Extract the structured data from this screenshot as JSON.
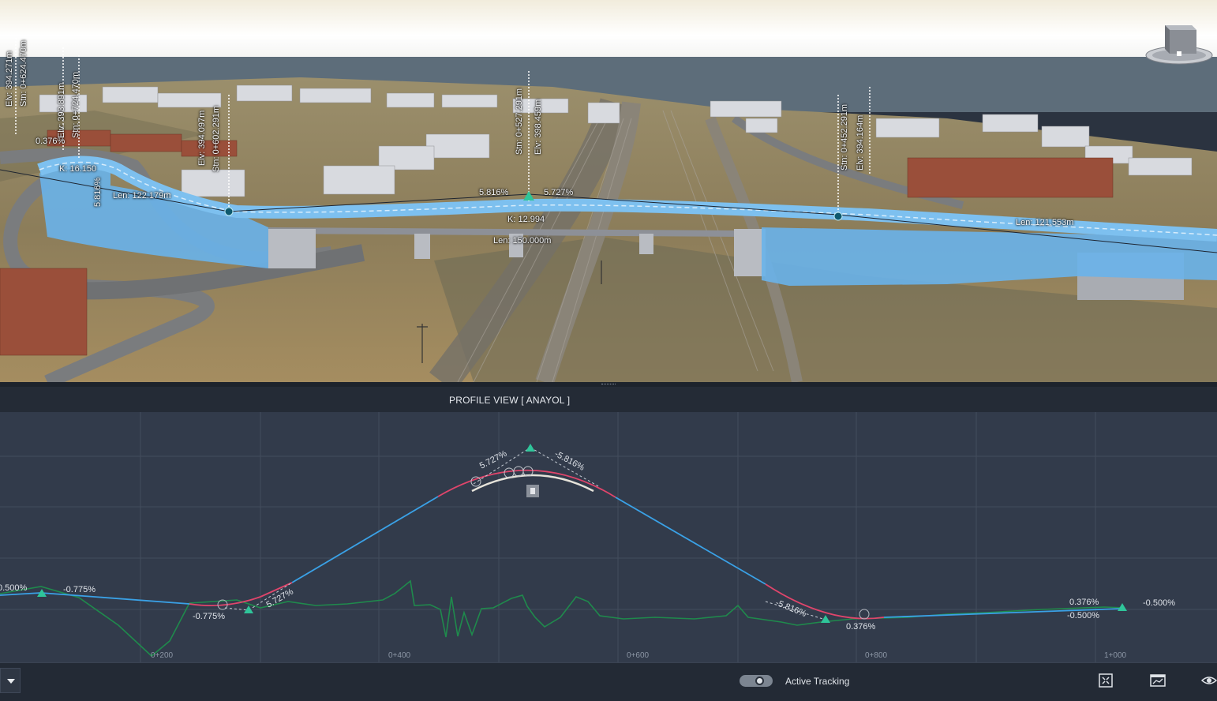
{
  "scene": {
    "labels": {
      "k_left": "K: 16.150",
      "len_left": "Len: 122.179m",
      "grade_left_top": "5.816%",
      "grade_right_top": "5.727%",
      "k_center": "K: 12.994",
      "len_center": "Len: 150.000m",
      "len_right": "Len: 121.553m",
      "grade_left_small": "0.376%",
      "grade_left_vert": "5.816%",
      "sta_left1": "Stn: 0+624.470m",
      "elv_left1": "Elv: 394.271m",
      "sta_left2": "Stn: 0+724.470m",
      "elv_left2": "Elv: 393.891m",
      "sta_mid": "Stn: 0+602.291m",
      "elv_mid": "Elv: 394.097m",
      "sta_center": "Stn: 0+527.291m",
      "elv_center": "Elv: 398.459m",
      "sta_right": "Stn: 0+452.291m",
      "elv_right": "Elv: 394.164m"
    }
  },
  "profile_view": {
    "title": "PROFILE VIEW [ ANAYOL ]",
    "grade_labels": {
      "left_edge": "0.500%",
      "left_a": "-0.775%",
      "left_b": "-0.775%",
      "left_c": "5.727%",
      "top_left": "5.727%",
      "top_right": "-5.816%",
      "right_a": "-5.816%",
      "right_b": "0.376%",
      "far_a": "0.376%",
      "far_b": "-0.500%",
      "far_c": "-0.500%"
    },
    "station_ticks": [
      "0+200",
      "0+400",
      "0+600",
      "0+800",
      "1+000"
    ],
    "colors": {
      "tangent": "#3aa1e6",
      "curve": "#e0456b",
      "ground": "#1f8a4c",
      "pvi_marker": "#2fc59a"
    }
  },
  "bottom_bar": {
    "tracking_label": "Active Tracking",
    "tracking_on": true,
    "icons": [
      "fullscreen-icon",
      "profile-chart-icon",
      "eye-icon"
    ]
  }
}
